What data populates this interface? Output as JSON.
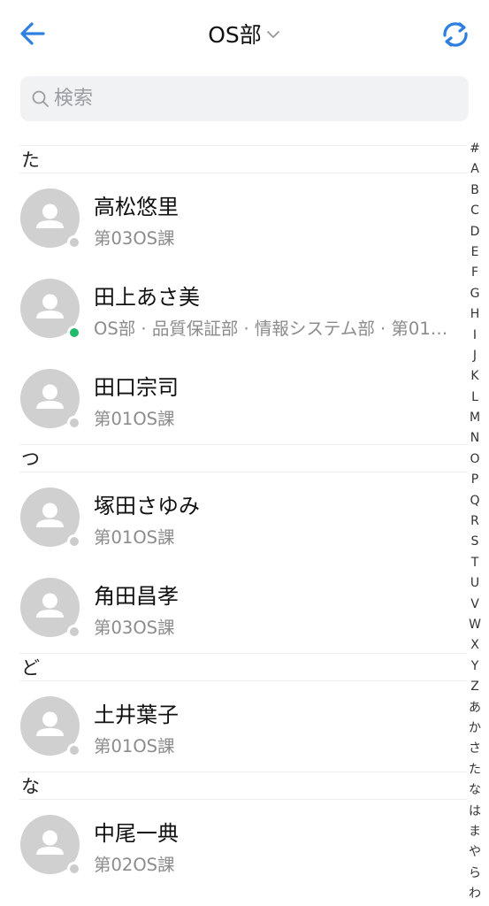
{
  "header": {
    "title": "OS部"
  },
  "search": {
    "placeholder": "検索"
  },
  "sections": [
    {
      "letter": "た",
      "contacts": [
        {
          "name": "高松悠里",
          "dept": "第03OS課",
          "status": "offline"
        },
        {
          "name": "田上あさ美",
          "dept": "OS部 · 品質保証部 · 情報システム部 · 第01…",
          "status": "online"
        },
        {
          "name": "田口宗司",
          "dept": "第01OS課",
          "status": "offline"
        }
      ]
    },
    {
      "letter": "つ",
      "contacts": [
        {
          "name": "塚田さゆみ",
          "dept": "第01OS課",
          "status": "offline"
        },
        {
          "name": "角田昌孝",
          "dept": "第03OS課",
          "status": "offline"
        }
      ]
    },
    {
      "letter": "ど",
      "contacts": [
        {
          "name": "土井葉子",
          "dept": "第01OS課",
          "status": "offline"
        }
      ]
    },
    {
      "letter": "な",
      "contacts": [
        {
          "name": "中尾一典",
          "dept": "第02OS課",
          "status": "offline"
        }
      ]
    }
  ],
  "index": [
    "#",
    "A",
    "B",
    "C",
    "D",
    "E",
    "F",
    "G",
    "H",
    "I",
    "J",
    "K",
    "L",
    "M",
    "N",
    "O",
    "P",
    "Q",
    "R",
    "S",
    "T",
    "U",
    "V",
    "W",
    "X",
    "Y",
    "Z",
    "あ",
    "か",
    "さ",
    "た",
    "な",
    "は",
    "ま",
    "や",
    "ら",
    "わ"
  ],
  "colors": {
    "accent": "#2f7fe0",
    "online": "#1fba6a",
    "offline": "#cccccc",
    "avatar": "#d0d0d0"
  },
  "icons": {
    "back": "arrow-left-icon",
    "refresh": "refresh-icon",
    "search": "search-icon",
    "avatar": "person-silhouette-icon",
    "title_dropdown": "chevron-down-icon"
  }
}
